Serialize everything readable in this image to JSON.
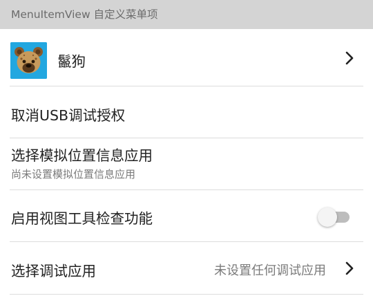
{
  "header": {
    "label": "MenuItemView 自定义菜单项"
  },
  "items": [
    {
      "title": "鬣狗",
      "icon": "hyena-avatar-icon",
      "has_chevron": true
    },
    {
      "title": "取消USB调试授权"
    },
    {
      "title": "选择模拟位置信息应用",
      "subtitle": "尚未设置模拟位置信息应用"
    },
    {
      "title": "启用视图工具检查功能",
      "toggle_on": false
    },
    {
      "title": "选择调试应用",
      "value": "未设置任何调试应用",
      "has_chevron": true
    }
  ],
  "colors": {
    "header_bg": "#d4d4d4",
    "avatar_bg": "#22a7e0",
    "toggle_track": "#bdbdbd",
    "toggle_thumb": "#f4f4f4"
  }
}
